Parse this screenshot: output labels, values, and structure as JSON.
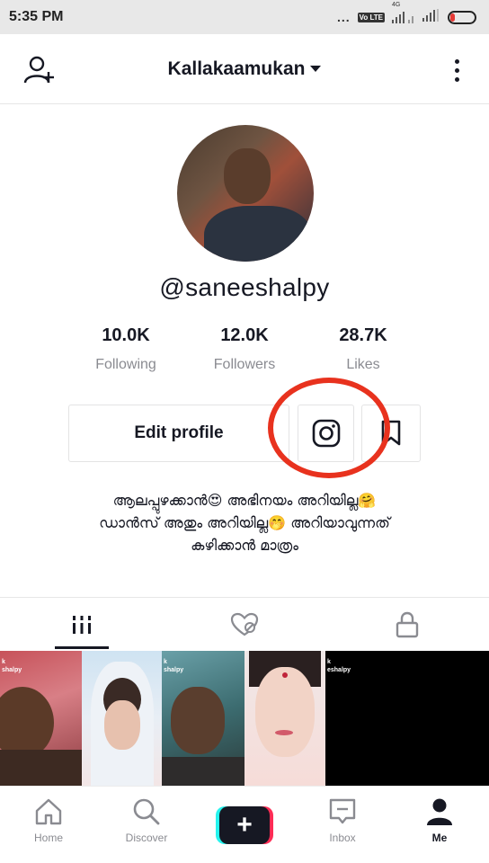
{
  "status_bar": {
    "time": "5:35 PM",
    "dots": "...",
    "volte": "Vo LTE",
    "network": "4G"
  },
  "header": {
    "title": "Kallakaamukan"
  },
  "profile": {
    "username": "@saneeshalpy",
    "stats": [
      {
        "value": "10.0K",
        "label": "Following"
      },
      {
        "value": "12.0K",
        "label": "Followers"
      },
      {
        "value": "28.7K",
        "label": "Likes"
      }
    ],
    "edit_label": "Edit profile",
    "bio_lines": [
      "ആലപ്പുഴക്കാൻ😍 അഭിനയം അറിയില്ല🤗",
      "ഡാൻസ് അതും അറിയില്ല🤭 അറിയാവുന്നത്",
      "കഴിക്കാൻ മാത്രം"
    ]
  },
  "videos": [
    {
      "label": "k\nshalpy"
    },
    {
      "label": ""
    },
    {
      "label": "k\nshalpy"
    },
    {
      "label": ""
    },
    {
      "label": "k\neshalpy"
    }
  ],
  "bottom_nav": [
    {
      "label": "Home"
    },
    {
      "label": "Discover"
    },
    {
      "label": "Inbox"
    },
    {
      "label": "Me"
    }
  ],
  "colors": {
    "accent_red": "#e8321e",
    "tiktok_pink": "#fe2c55",
    "tiktok_cyan": "#25f4ee"
  }
}
